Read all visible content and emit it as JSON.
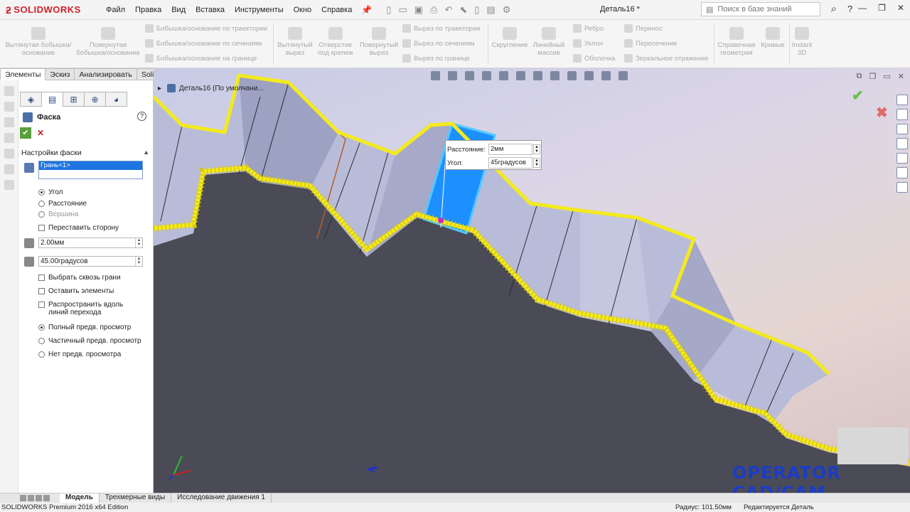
{
  "app": {
    "logo": "SOLIDWORKS",
    "doc_title": "Деталь16 *",
    "search_placeholder": "Поиск в базе знаний",
    "help_icon": "?"
  },
  "menu": [
    "Файл",
    "Правка",
    "Вид",
    "Вставка",
    "Инструменты",
    "Окно",
    "Справка"
  ],
  "ribbon": {
    "big": [
      {
        "label": "Вытянутая бобышка/основание"
      },
      {
        "label": "Повернутая бобышка/основание"
      },
      {
        "label": "Вытянутый вырез"
      },
      {
        "label": "Отверстие под крепеж"
      },
      {
        "label": "Повернутый вырез"
      },
      {
        "label": "Скругление"
      },
      {
        "label": "Линейный массив"
      },
      {
        "label": "Справочная геометрия"
      },
      {
        "label": "Кривые"
      },
      {
        "label": "Instant 3D"
      }
    ],
    "small": [
      "Бобышка/основание по траектории",
      "Бобышка/основание по сечениям",
      "Бобышка/основание на границе",
      "Вырез по траектории",
      "Вырез по сечениям",
      "Вырез по границе",
      "Ребро",
      "Уклон",
      "Оболочка",
      "Перенос",
      "Пересечение",
      "Зеркальное отражение"
    ]
  },
  "tabs": [
    "Элементы",
    "Эскиз",
    "Анализировать",
    "SolidCAM Переходы"
  ],
  "pm": {
    "title": "Фаска",
    "section": "Настройки фаски",
    "face_item": "Грань<1>",
    "type_options": [
      "Угол",
      "Расстояние",
      "Вершина"
    ],
    "flip": "Переставить сторону",
    "distance": "2.00мм",
    "angle": "45.00градусов",
    "checks": [
      "Выбрать сквозь грани",
      "Оставить элементы",
      "Распространить вдоль линий перехода"
    ],
    "preview": [
      "Полный предв. просмотр",
      "Частичный предв. просмотр",
      "Нет предв. просмотра"
    ]
  },
  "viewport": {
    "tree_label": "Деталь16 (По умолчани...",
    "callout": {
      "dist_label": "Расстояние:",
      "dist_value": "2мм",
      "angle_label": "Угол:",
      "angle_value": "45градусов"
    },
    "watermark": "OPERATOR CAD/CAM"
  },
  "bottom_tabs": [
    "Модель",
    "Трехмерные виды",
    "Исследование движения 1"
  ],
  "status": {
    "left": "SOLIDWORKS Premium 2016 x64 Edition",
    "radius": "Радиус: 101.50мм",
    "edit": "Редактируется Деталь"
  },
  "colors": {
    "accent": "#d0202a",
    "selected_face": "#1e8fff",
    "highlight": "#f3ea1e",
    "part_dark": "#4a4b56"
  }
}
